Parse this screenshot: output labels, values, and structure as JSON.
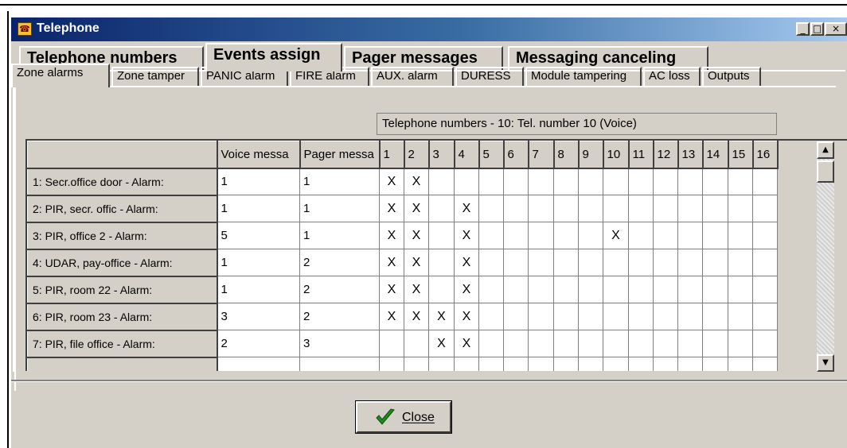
{
  "window": {
    "title": "Telephone",
    "controls": {
      "minimize": "_",
      "maximize": "□",
      "close": "×"
    }
  },
  "main_tabs": [
    {
      "label": "Telephone numbers",
      "active": false
    },
    {
      "label": "Events assign",
      "active": true
    },
    {
      "label": "Pager messages",
      "active": false
    },
    {
      "label": "Messaging canceling",
      "active": false
    }
  ],
  "sub_tabs": [
    {
      "label": "Zone alarms",
      "active": true
    },
    {
      "label": "Zone tamper",
      "active": false
    },
    {
      "label": "PANIC alarm",
      "active": false
    },
    {
      "label": "FIRE alarm",
      "active": false
    },
    {
      "label": "AUX. alarm",
      "active": false
    },
    {
      "label": "DURESS",
      "active": false
    },
    {
      "label": "Module tampering",
      "active": false
    },
    {
      "label": "AC loss",
      "active": false
    },
    {
      "label": "Outputs",
      "active": false
    }
  ],
  "grid": {
    "caption": "Telephone numbers -  10: Tel. number 10   (Voice)",
    "headers": [
      "",
      "Voice messa",
      "Pager messa",
      "1",
      "2",
      "3",
      "4",
      "5",
      "6",
      "7",
      "8",
      "9",
      "10",
      "11",
      "12",
      "13",
      "14",
      "15",
      "16"
    ],
    "mark_symbol": "X",
    "rows": [
      {
        "label": "1: Secr.office door - Alarm:",
        "voice": "1",
        "pager": "1",
        "marks": [
          1,
          2
        ]
      },
      {
        "label": "2: PIR, secr. offic - Alarm:",
        "voice": "1",
        "pager": "1",
        "marks": [
          1,
          2,
          4
        ]
      },
      {
        "label": "3: PIR, office 2    - Alarm:",
        "voice": "5",
        "pager": "1",
        "marks": [
          1,
          2,
          4,
          10
        ]
      },
      {
        "label": "4: UDAR, pay-office - Alarm:",
        "voice": "1",
        "pager": "2",
        "marks": [
          1,
          2,
          4
        ]
      },
      {
        "label": "5: PIR, room 22      - Alarm:",
        "voice": "1",
        "pager": "2",
        "marks": [
          1,
          2,
          4
        ]
      },
      {
        "label": "6: PIR, room 23      - Alarm:",
        "voice": "3",
        "pager": "2",
        "marks": [
          1,
          2,
          3,
          4
        ]
      },
      {
        "label": "7: PIR, file office - Alarm:",
        "voice": "2",
        "pager": "3",
        "marks": [
          3,
          4
        ]
      },
      {
        "label": "",
        "voice": "",
        "pager": "",
        "marks": []
      }
    ],
    "focused_cell": {
      "row": 3,
      "column": "10"
    }
  },
  "scrollbar": {
    "up": "▲",
    "down": "▼"
  },
  "footer": {
    "close_label": "Close"
  },
  "colors": {
    "title_start": "#0a246a",
    "title_end": "#a6caf0",
    "face": "#d4d0c8",
    "check": "#1f8a1f"
  }
}
